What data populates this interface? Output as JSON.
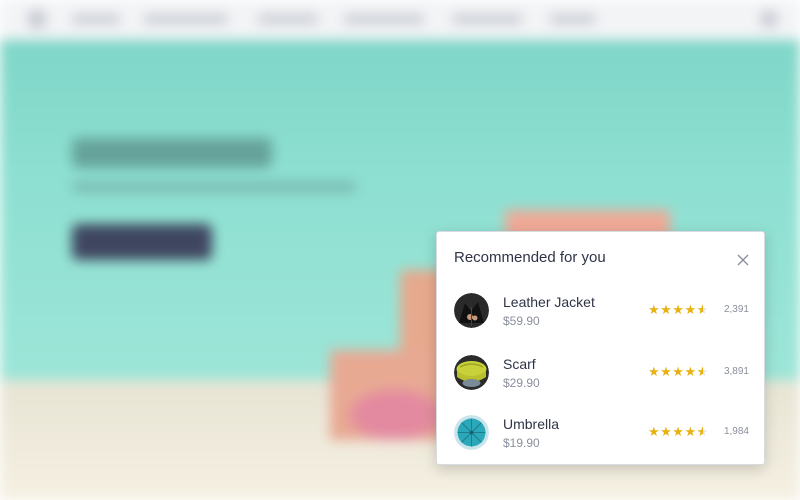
{
  "popup": {
    "title": "Recommended for you"
  },
  "items": [
    {
      "name": "Leather Jacket",
      "price": "$59.90",
      "rating": 4.5,
      "count": "2,391",
      "thumb_icon": "leather-jacket-thumbnail"
    },
    {
      "name": "Scarf",
      "price": "$29.90",
      "rating": 4.5,
      "count": "3,891",
      "thumb_icon": "scarf-thumbnail"
    },
    {
      "name": "Umbrella",
      "price": "$19.90",
      "rating": 4.5,
      "count": "1,984",
      "thumb_icon": "umbrella-thumbnail"
    }
  ],
  "colors": {
    "star": "#e8b10f",
    "title_text": "#2f3447",
    "muted_text": "#8a8f9c",
    "hero_bg": "#8ee0d2"
  }
}
